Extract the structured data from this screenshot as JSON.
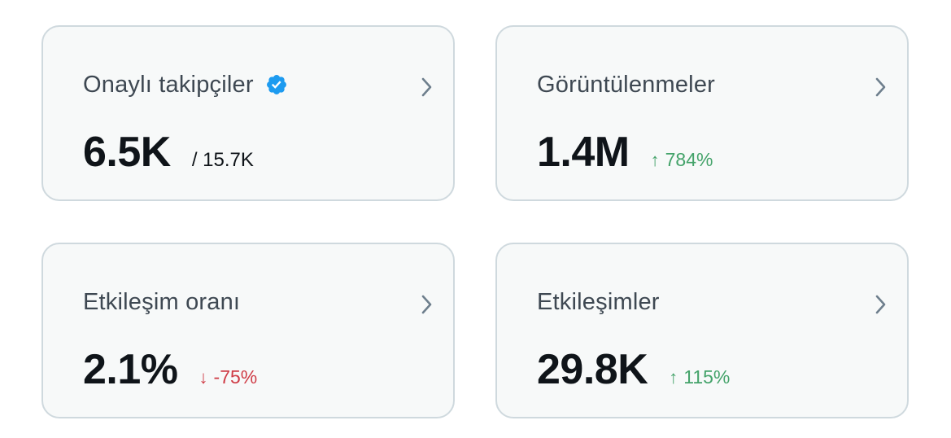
{
  "cards": [
    {
      "title": "Onaylı takipçiler",
      "has_verified_badge": true,
      "value": "6.5K",
      "sub_value": "/ 15.7K",
      "icon": "chevron-right-icon"
    },
    {
      "title": "Görüntülenmeler",
      "value": "1.4M",
      "delta_arrow": "↑",
      "delta": "784%",
      "delta_direction": "up",
      "icon": "chevron-right-icon"
    },
    {
      "title": "Etkileşim oranı",
      "value": "2.1%",
      "delta_arrow": "↓",
      "delta": "-75%",
      "delta_direction": "down",
      "icon": "chevron-right-icon"
    },
    {
      "title": "Etkileşimler",
      "value": "29.8K",
      "delta_arrow": "↑",
      "delta": "115%",
      "delta_direction": "up",
      "icon": "chevron-right-icon"
    }
  ],
  "colors": {
    "card_background": "#f7f9f9",
    "card_border": "#cfd9de",
    "verified_badge": "#1d9bf0",
    "positive": "#44a36a",
    "negative": "#cf3c46"
  }
}
